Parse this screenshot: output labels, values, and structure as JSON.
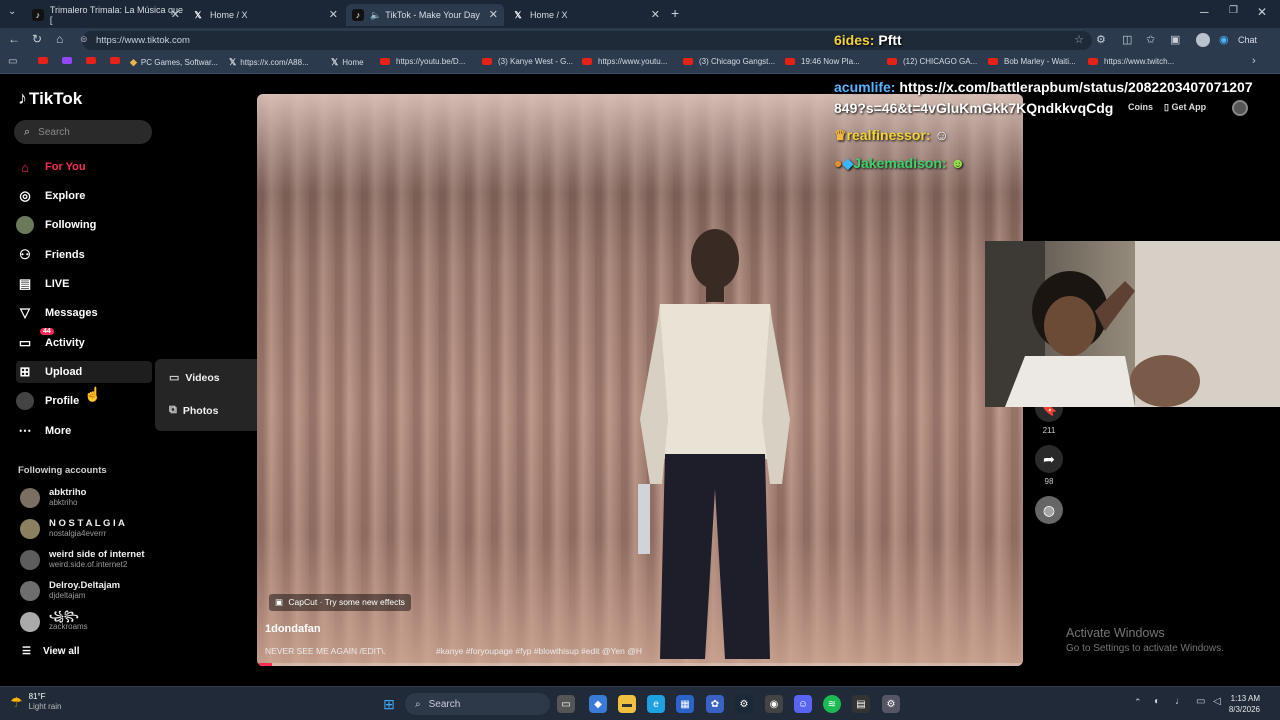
{
  "browser": {
    "tabs": [
      {
        "title": "Trimalero Trimala: La Música que [",
        "icon": "tiktok"
      },
      {
        "title": "Home / X",
        "icon": "x"
      },
      {
        "title": "TikTok - Make Your Day",
        "icon": "tiktok",
        "active": true
      },
      {
        "title": "Home / X",
        "icon": "x"
      }
    ],
    "url": "https://www.tiktok.com",
    "chat_label": "Chat",
    "bookmarks": [
      "PC Games, Softwar...",
      "https://x.com/A88...",
      "Home",
      "https://youtu.be/D...",
      "(3) Kanye West - G...",
      "https://www.youtu...",
      "(3) Chicago Gangst...",
      "19:46 Now Pla...",
      "(12) CHICAGO GA...",
      "Bob Marley - Waiti...",
      "https://www.twitch..."
    ]
  },
  "tiktok": {
    "logo": "TikTok",
    "search_placeholder": "Search",
    "nav": {
      "for_you": "For You",
      "explore": "Explore",
      "following": "Following",
      "friends": "Friends",
      "live": "LIVE",
      "messages": "Messages",
      "activity": "Activity",
      "activity_badge": "44",
      "upload": "Upload",
      "profile": "Profile",
      "more": "More"
    },
    "upload_menu": {
      "videos": "Videos",
      "photos": "Photos"
    },
    "following_header": "Following accounts",
    "accounts": [
      {
        "name": "abktriho",
        "handle": "abktriho"
      },
      {
        "name": "N O S T A L G I A",
        "handle": "nostalgia4everrr"
      },
      {
        "name": "weird side of internet",
        "handle": "weird.side.of.internet2"
      },
      {
        "name": "Delroy.Deltajam",
        "handle": "djdeltajam"
      },
      {
        "name": "꧁꧂",
        "handle": "zackroams"
      }
    ],
    "view_all": "View all",
    "coins": "Coins",
    "get_app": "Get App",
    "video": {
      "capcut": "CapCut · Try some new effects",
      "username": "1dondafan",
      "description": "NEVER SEE ME AGAIN /EDIT\\.",
      "hashtags": "#kanye #foryoupage #fyp #blowthisup #edit @Yen @H",
      "progress": 0.02,
      "bookmark_count": "211",
      "share_count": "98"
    }
  },
  "stream_chat": {
    "line1_user": "6ides:",
    "line1_msg": "Pftt",
    "line2_user": "acumlife:",
    "line2_msg": "https://x.com/battlerapbum/status/2082203407071207",
    "line2_msg2": "849?s=46&t=4vGluKmGkk7KQndkkvqCdg",
    "line3_user": "realfinessor:",
    "line4_user": "Jakemadison:"
  },
  "windows": {
    "activate_title": "Activate Windows",
    "activate_sub": "Go to Settings to activate Windows.",
    "weather_temp": "81°F",
    "weather_desc": "Light rain",
    "taskbar_search": "Search",
    "time": "1:13 AM",
    "date": "8/3/2026"
  },
  "colors": {
    "tiktok_red": "#fe2c55",
    "chat_yellow": "#f3d33b",
    "chat_blue": "#5ab4ff",
    "chat_green": "#3fd06a"
  }
}
